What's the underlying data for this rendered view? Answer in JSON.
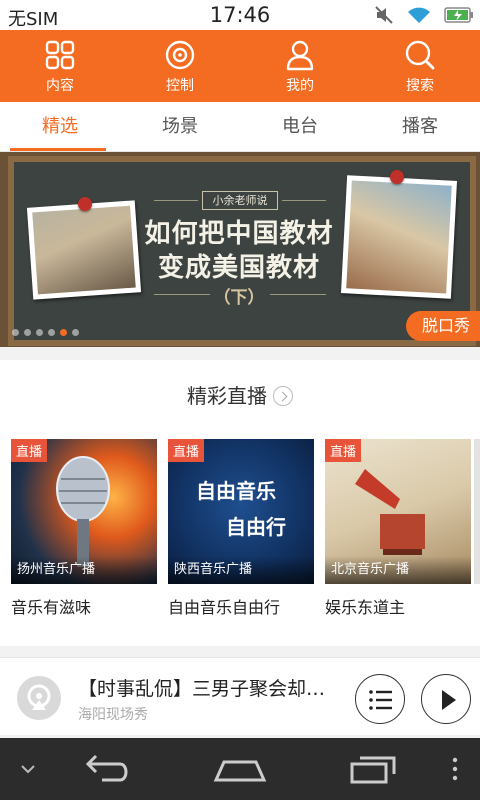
{
  "status_bar": {
    "carrier": "无SIM",
    "time": "17:46"
  },
  "top_nav": [
    {
      "label": "内容",
      "icon": "grid-icon"
    },
    {
      "label": "控制",
      "icon": "control-dial-icon"
    },
    {
      "label": "我的",
      "icon": "person-icon"
    },
    {
      "label": "搜索",
      "icon": "search-icon"
    }
  ],
  "sub_tabs": [
    {
      "label": "精选",
      "active": true
    },
    {
      "label": "场景",
      "active": false
    },
    {
      "label": "电台",
      "active": false
    },
    {
      "label": "播客",
      "active": false
    }
  ],
  "banner": {
    "tag": "小余老师说",
    "line1": "如何把中国教材",
    "line2": "变成美国教材",
    "line3": "（下）",
    "badge": "脱口秀",
    "page_count": 6,
    "active_page": 5
  },
  "live_section": {
    "title": "精彩直播",
    "cards": [
      {
        "badge": "直播",
        "station": "扬州音乐广播",
        "name": "音乐有滋味"
      },
      {
        "badge": "直播",
        "station": "陕西音乐广播",
        "name": "自由音乐自由行",
        "art_text_1": "自由音乐",
        "art_text_2": "自由行"
      },
      {
        "badge": "直播",
        "station": "北京音乐广播",
        "name": "娱乐东道主"
      }
    ]
  },
  "player": {
    "title": "【时事乱侃】三男子聚会却…",
    "subtitle": "海阳现场秀"
  },
  "colors": {
    "accent": "#f36c21",
    "live_badge": "#e8543a"
  }
}
